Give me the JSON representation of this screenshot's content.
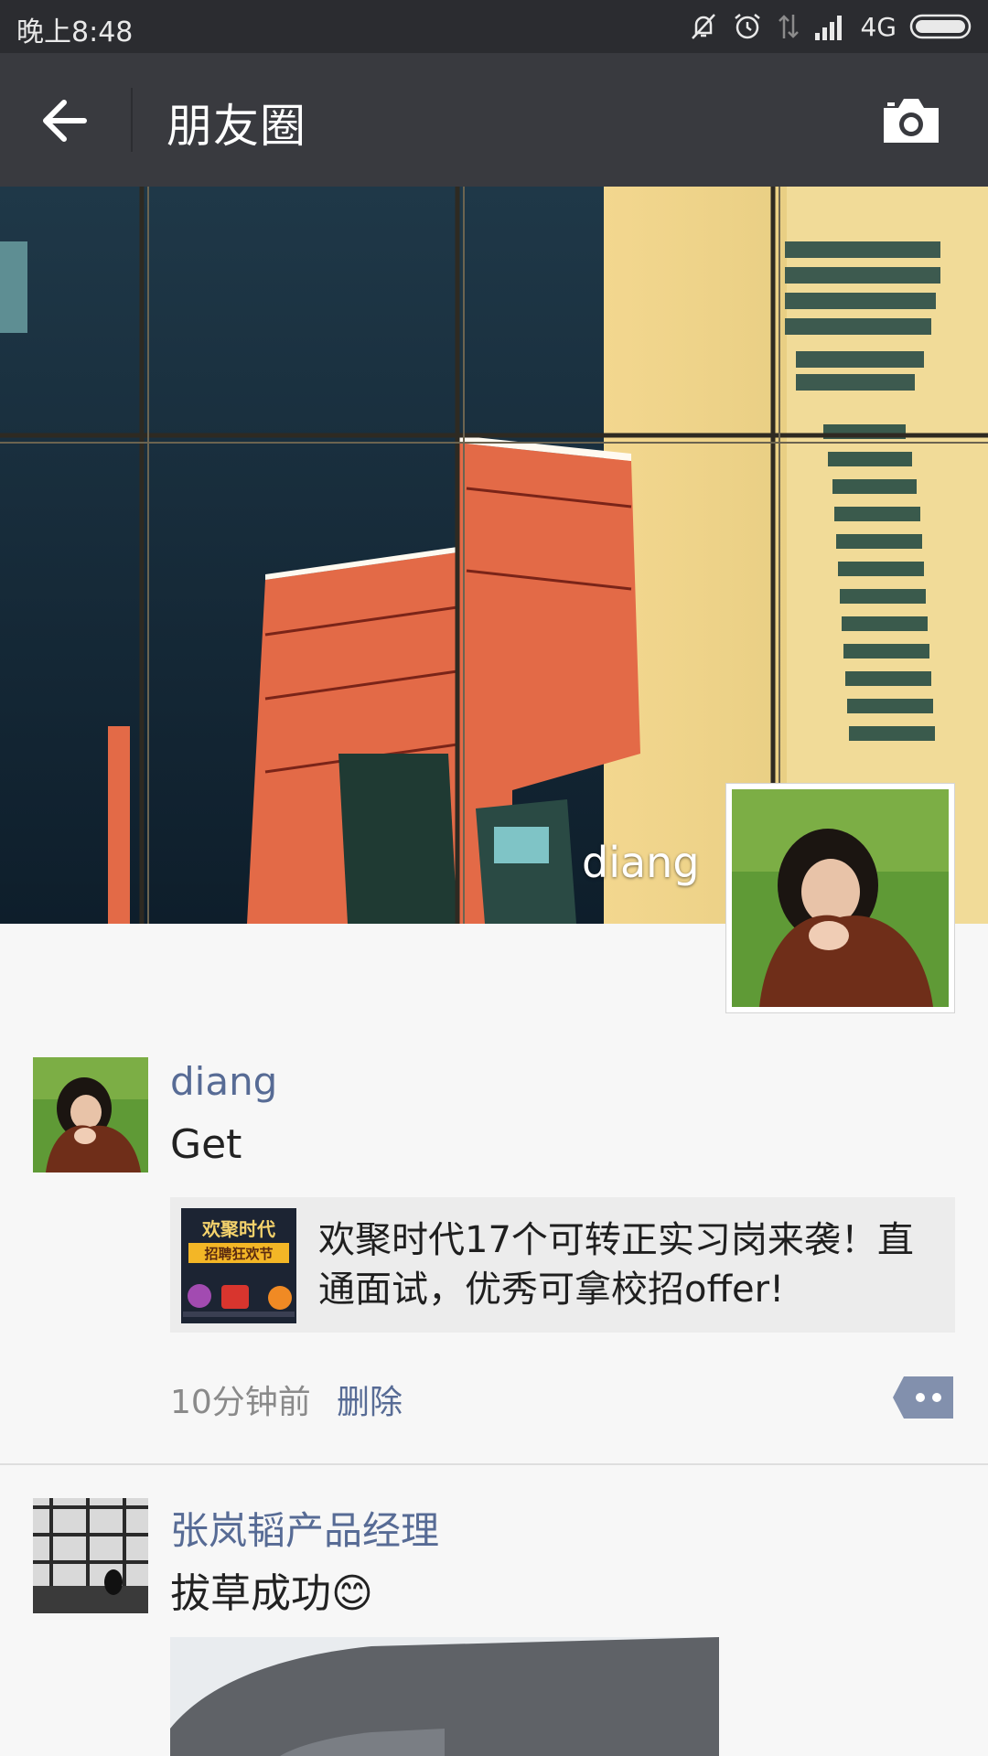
{
  "status_bar": {
    "time": "晚上8:48",
    "network": "4G",
    "icons": [
      "bell-off-icon",
      "alarm-icon",
      "data-transfer-icon",
      "signal-icon",
      "battery-icon"
    ]
  },
  "header": {
    "title": "朋友圈",
    "back_icon": "back-arrow-icon",
    "camera_icon": "camera-icon"
  },
  "cover": {
    "username": "diang"
  },
  "posts": [
    {
      "name": "diang",
      "text": "Get",
      "link": {
        "thumb_line1": "欢聚时代",
        "thumb_line2": "招聘狂欢节",
        "title": "欢聚时代17个可转正实习岗来袭！直通面试，优秀可拿校招offer!"
      },
      "time": "10分钟前",
      "delete_label": "删除"
    },
    {
      "name": "张岚韬产品经理",
      "text": "拔草成功😊"
    }
  ],
  "colors": {
    "status_bar": "#2b2c30",
    "title_bar": "#393a3f",
    "link_blue": "#576b95",
    "page_bg": "#f7f7f7"
  }
}
